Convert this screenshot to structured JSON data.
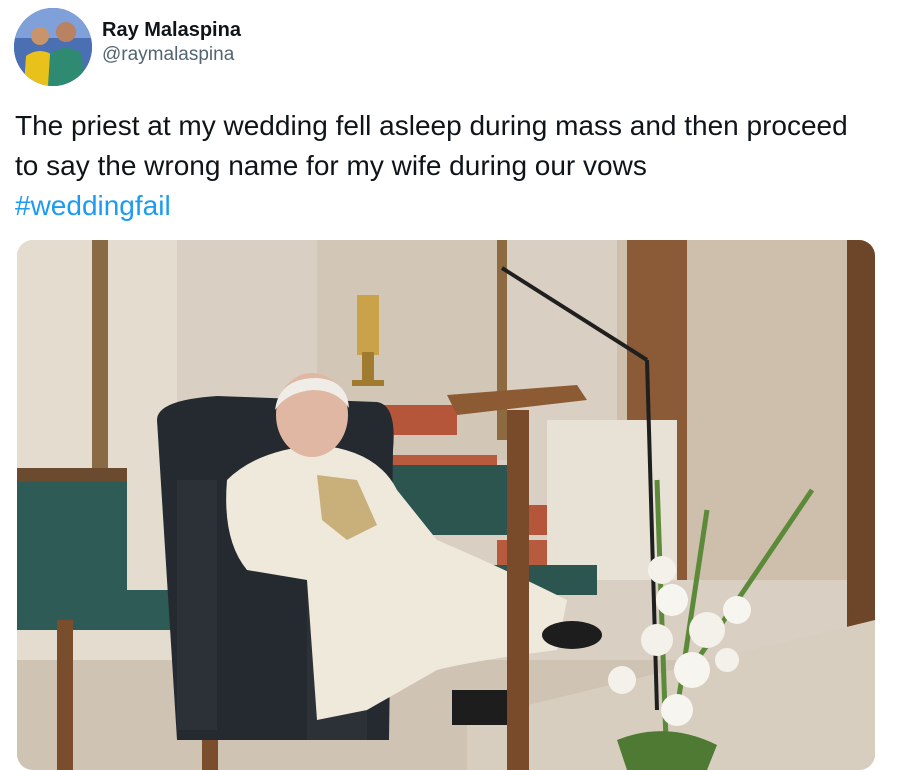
{
  "author": {
    "display_name": "Ray Malaspina",
    "handle": "@raymalaspina"
  },
  "tweet": {
    "text": "The priest at my wedding fell asleep during mass and then proceed to say the wrong name for my wife during our vows",
    "hashtag": "#weddingfail"
  },
  "colors": {
    "hashtag": "#1d9bf0",
    "handle": "#536471",
    "text": "#0f1419"
  },
  "icons": [
    "avatar"
  ]
}
